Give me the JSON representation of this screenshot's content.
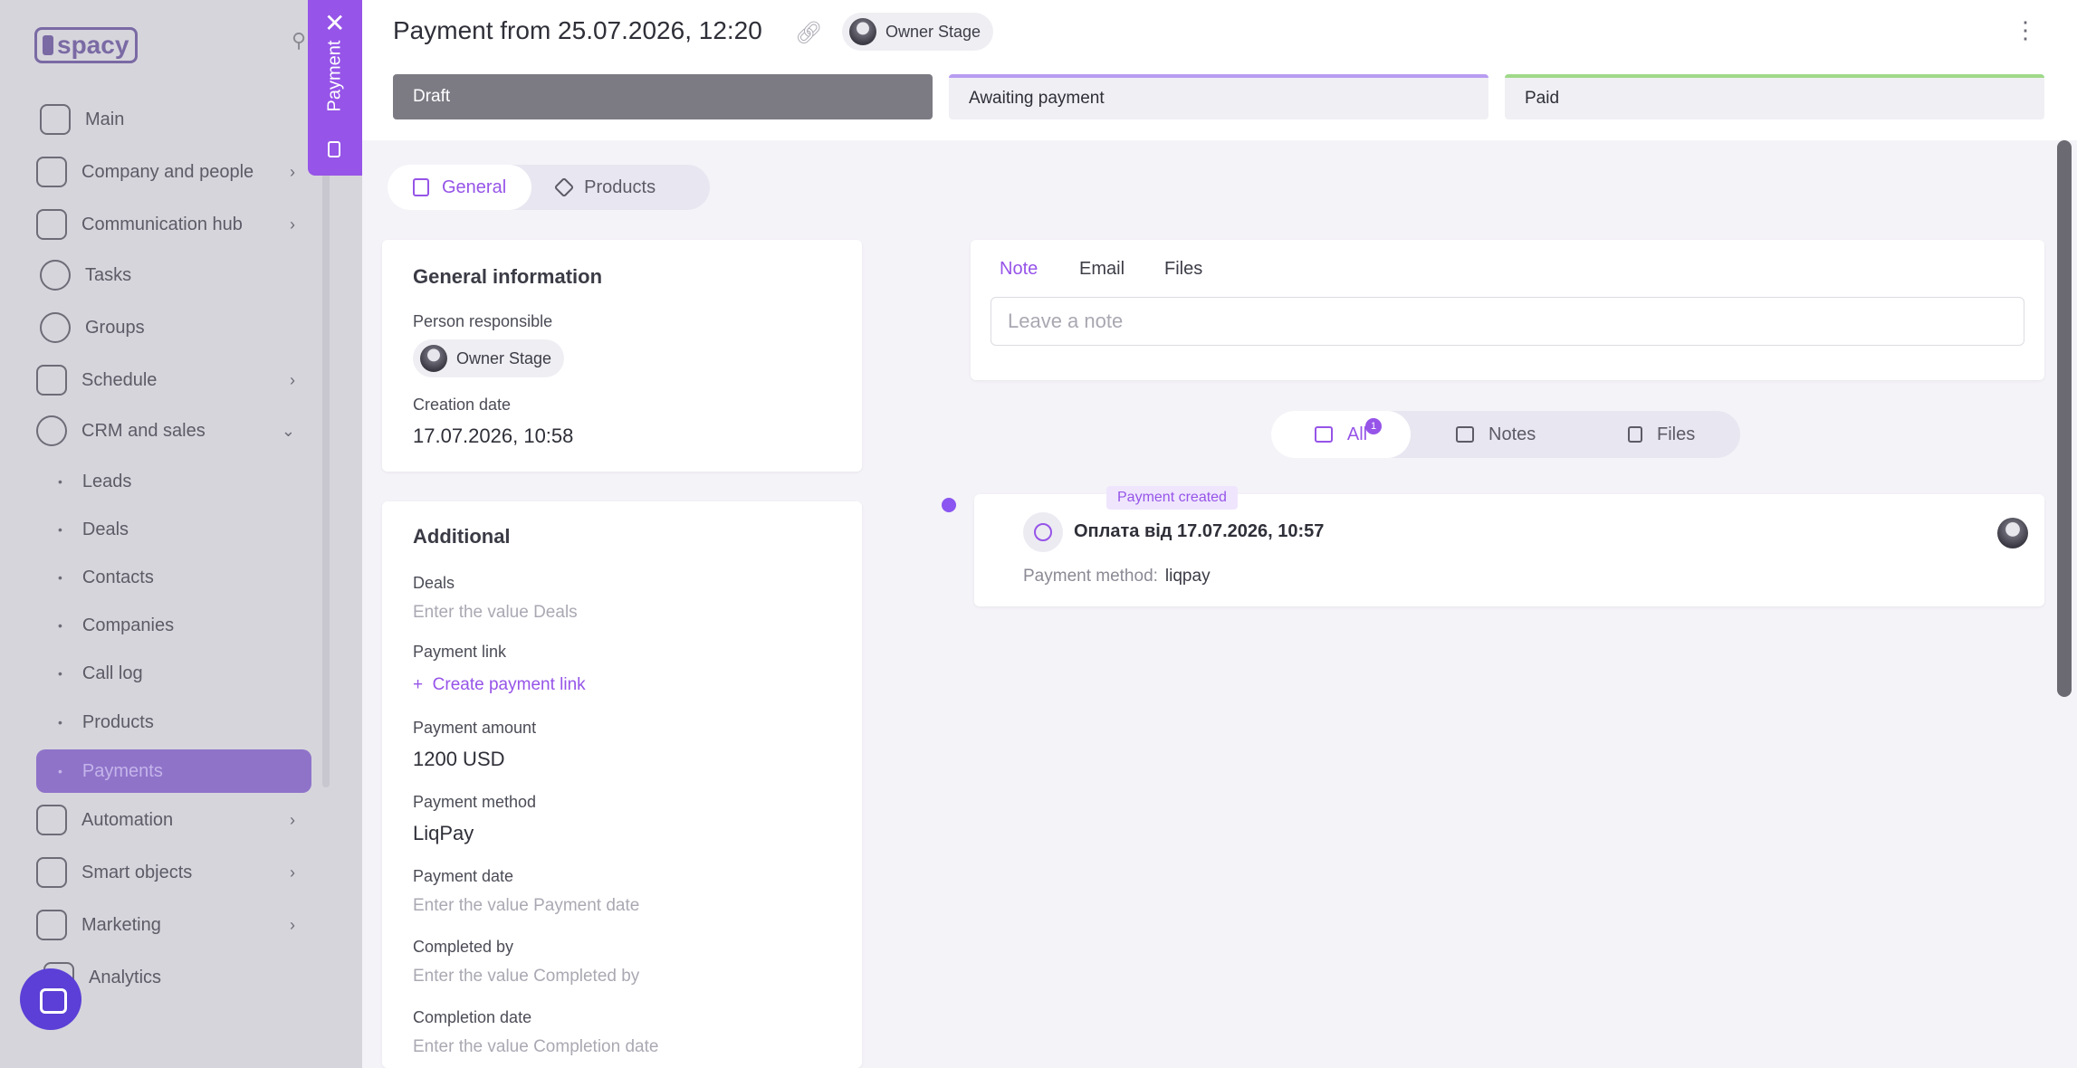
{
  "sidebar": {
    "logo": "spacy",
    "items": [
      {
        "label": "Main",
        "icon": "home-icon"
      },
      {
        "label": "Company and people",
        "icon": "building-icon",
        "chevron": true
      },
      {
        "label": "Communication hub",
        "icon": "chat-edit-icon",
        "chevron": true
      },
      {
        "label": "Tasks",
        "icon": "check-circle-icon"
      },
      {
        "label": "Groups",
        "icon": "people-icon"
      },
      {
        "label": "Schedule",
        "icon": "calendar-icon",
        "chevron": true
      },
      {
        "label": "CRM and sales",
        "icon": "crm-icon",
        "chevron": true,
        "expanded": true
      }
    ],
    "crm_sub": [
      "Leads",
      "Deals",
      "Contacts",
      "Companies",
      "Call log",
      "Products",
      "Payments"
    ],
    "items_bottom": [
      {
        "label": "Automation",
        "icon": "lightning-icon"
      },
      {
        "label": "Smart objects",
        "icon": "scan-icon"
      },
      {
        "label": "Marketing",
        "icon": "megaphone-icon"
      },
      {
        "label": "Analytics",
        "icon": "chart-icon"
      }
    ]
  },
  "vertical_tab": {
    "label": "Payment"
  },
  "header": {
    "title": "Payment from 25.07.2026, 12:20",
    "owner": "Owner Stage",
    "stages": [
      "Draft",
      "Awaiting payment",
      "Paid"
    ]
  },
  "tabs": {
    "general": "General",
    "products": "Products"
  },
  "general_info": {
    "heading": "General information",
    "person_label": "Person responsible",
    "person_value": "Owner Stage",
    "creation_label": "Creation date",
    "creation_value": "17.07.2026, 10:58"
  },
  "additional": {
    "heading": "Additional",
    "deals_label": "Deals",
    "deals_placeholder": "Enter the value Deals",
    "link_label": "Payment link",
    "link_action": "Create payment link",
    "amount_label": "Payment amount",
    "amount_value": "1200 USD",
    "method_label": "Payment method",
    "method_value": "LiqPay",
    "date_label": "Payment date",
    "date_placeholder": "Enter the value Payment date",
    "completed_label": "Completed by",
    "completed_placeholder": "Enter the value Completed by",
    "completion_label": "Completion date",
    "completion_placeholder": "Enter the value Completion date"
  },
  "note_panel": {
    "tabs": [
      "Note",
      "Email",
      "Files"
    ],
    "placeholder": "Leave a note"
  },
  "filters": {
    "all": "All",
    "all_count": "1",
    "notes": "Notes",
    "files": "Files"
  },
  "event": {
    "tag": "Payment created",
    "title": "Оплата від 17.07.2026, 10:57",
    "meta_label": "Payment method:",
    "meta_value": "liqpay"
  },
  "colors": {
    "accent": "#9654e8",
    "draft": "#7c7b84",
    "awaiting": "#b89cf2",
    "paid": "#9fd98a"
  }
}
